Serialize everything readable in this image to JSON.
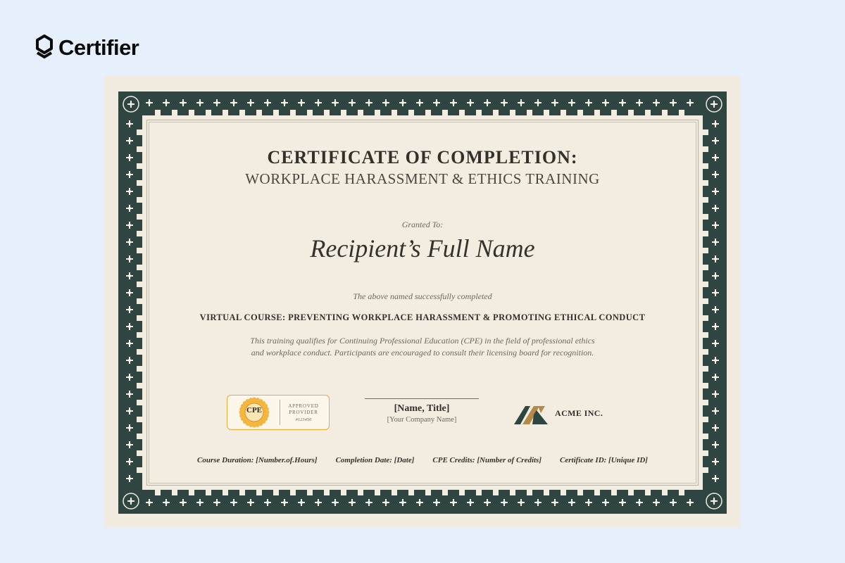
{
  "brand": {
    "name": "Certifier",
    "icon": "certifier-logo-icon"
  },
  "colors": {
    "page_background": "#e6f0fc",
    "paper": "#f2ebe0",
    "border": "#2f4541",
    "border_motif": "#f3ece1",
    "badge_accent": "#f0a83c",
    "logo_gold": "#b58a48",
    "logo_dark": "#2f4541"
  },
  "certificate": {
    "title": "CERTIFICATE OF COMPLETION:",
    "subtitle": "WORKPLACE HARASSMENT & ETHICS TRAINING",
    "granted_label": "Granted To:",
    "recipient": "Recipient’s Full Name",
    "completed_text": "The above named successfully completed",
    "course": "VIRTUAL COURSE: PREVENTING WORKPLACE HARASSMENT & PROMOTING ETHICAL CONDUCT",
    "description": [
      "This training qualifies for Continuing Professional Education (CPE) in the field of professional ethics",
      "and workplace conduct. Participants are encouraged to consult their licensing board for recognition."
    ],
    "badge": {
      "seal": "CPE",
      "approved": [
        "APPROVED",
        "PROVIDER"
      ],
      "number": "#123456"
    },
    "signature": {
      "name": "[Name, Title]",
      "company": "[Your Company Name]"
    },
    "company": {
      "name": "ACME INC.",
      "icon": "acme-logo-icon"
    },
    "footer": [
      "Course Duration: [Number.of.Hours]",
      "Completion Date: [Date]",
      "CPE Credits: [Number of Credits]",
      "Certificate ID: [Unique ID]"
    ]
  }
}
